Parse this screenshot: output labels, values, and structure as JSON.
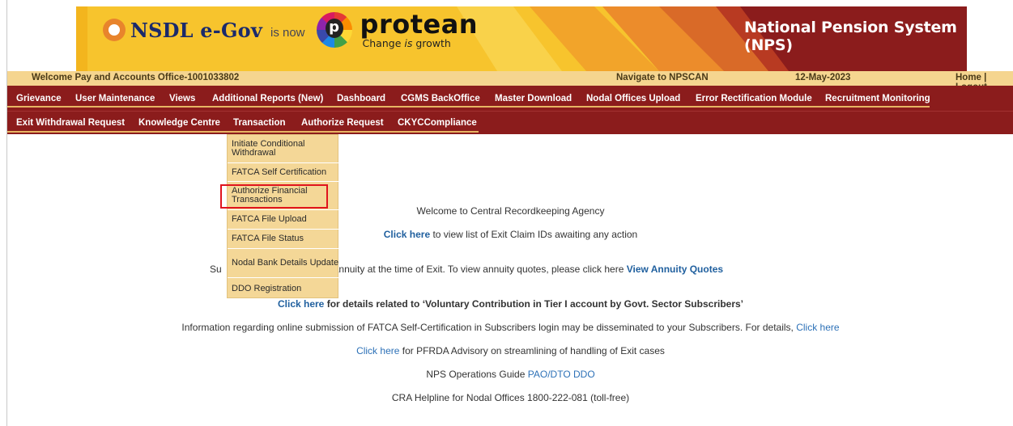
{
  "banner": {
    "nsdl_brand": "NSDL e-Gov",
    "is_now": "is now",
    "protean_brand": "protean",
    "protean_tagline_1": "Change",
    "protean_tagline_is": "is",
    "protean_tagline_2": "growth",
    "system_title": "National Pension System (NPS)",
    "colors": {
      "stripe_yellow": "#f7c42d",
      "stripe_orange": "#e8892a",
      "title_bg": "#8b1c1c"
    }
  },
  "welcome_bar": {
    "welcome_text": "Welcome Pay and Accounts Office-1001033802",
    "navigate_link": "Navigate to NPSCAN",
    "date": "12-May-2023",
    "home_link": "Home",
    "separator": "|",
    "logout_link": "Logout"
  },
  "nav": {
    "row1": [
      "Grievance",
      "User Maintenance",
      "Views",
      "Additional Reports (New)",
      "Dashboard",
      "CGMS BackOffice",
      "Master Download",
      "Nodal Offices Upload",
      "Error Rectification Module",
      "Recruitment Monitoring"
    ],
    "row2": [
      "Exit Withdrawal Request",
      "Knowledge Centre",
      "Transaction",
      "Authorize Request",
      "CKYCCompliance"
    ]
  },
  "transaction_menu": {
    "items": [
      "Initiate Conditional Withdrawal",
      "FATCA Self Certification",
      "Authorize Financial Transactions",
      "FATCA File Upload",
      "FATCA File Status",
      "Nodal Bank Details Update",
      "DDO Registration"
    ],
    "highlighted_index": 2
  },
  "content": {
    "welcome_line": "Welcome to Central Recordkeeping Agency",
    "exit_claim": {
      "link": "Click here",
      "text": " to view list of Exit Claim IDs awaiting any action"
    },
    "annuity": {
      "prefix": "Su",
      "text": "urchase the annuity at the time of Exit. To view annuity quotes, please click here ",
      "link": "View Annuity Quotes"
    },
    "voluntary": {
      "link": "Click here",
      "text": " for details related to ‘Voluntary Contribution in Tier I account by Govt. Sector Subscribers’"
    },
    "fatca": {
      "text": "Information regarding online submission of FATCA Self-Certification in Subscribers login may be disseminated to your Subscribers. For details, ",
      "link": "Click here"
    },
    "pfrda": {
      "link": "Click here",
      "text": " for PFRDA Advisory on streamlining of handling of Exit cases"
    },
    "guide": {
      "text": "NPS Operations Guide ",
      "link": "PAO/DTO DDO"
    },
    "helpline": "CRA Helpline for Nodal Offices 1800-222-081 (toll-free)"
  }
}
